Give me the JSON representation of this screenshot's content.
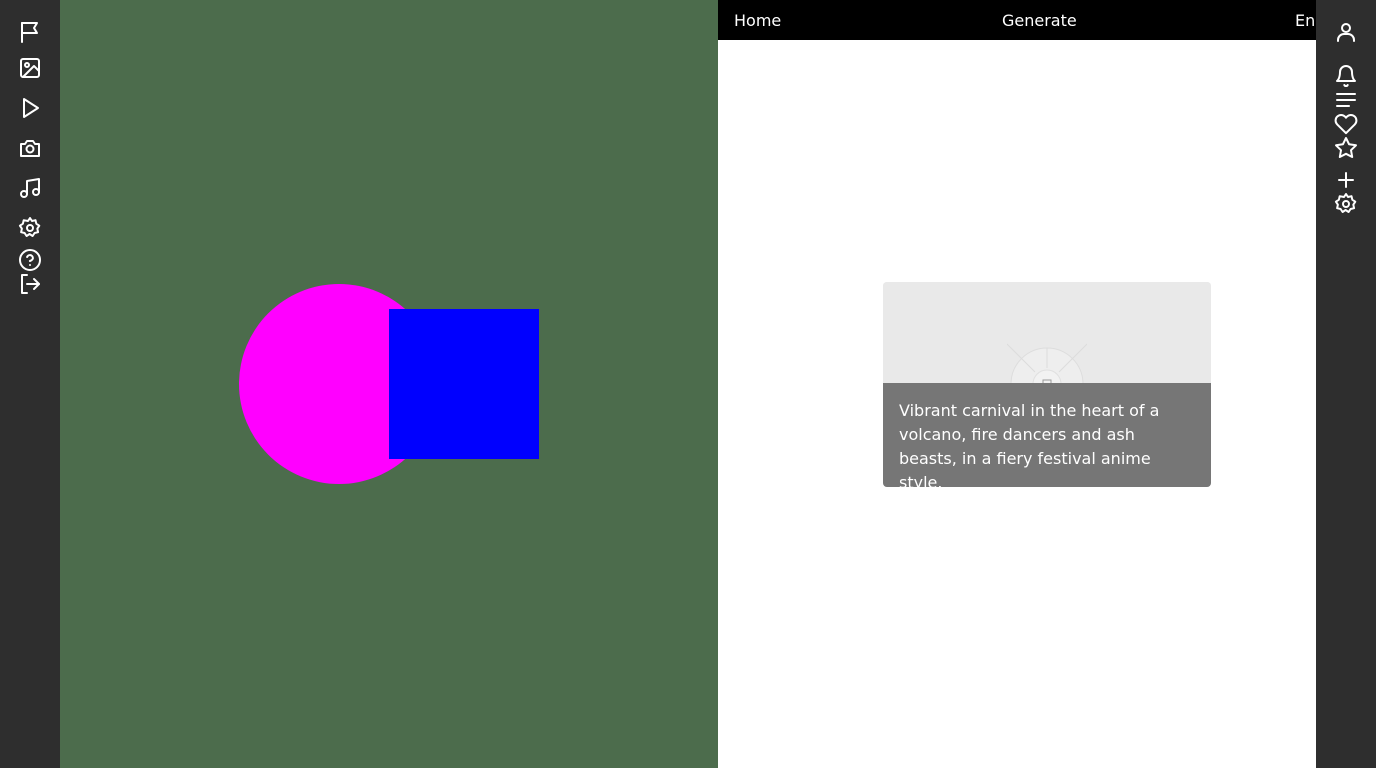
{
  "nav": {
    "home": "Home",
    "generate": "Generate",
    "third": "Enh"
  },
  "card": {
    "caption": "Vibrant carnival in the heart of a volcano, fire dancers and ash beasts, in a fiery festival anime style."
  },
  "canvas": {
    "background": "#4c6c4c",
    "circle_color": "#ff00ff",
    "square_color": "#0000ff"
  },
  "left_rail_icons": [
    "flag-icon",
    "image-icon",
    "play-icon",
    "camera-icon",
    "music-icon",
    "settings-icon",
    "help-icon",
    "logout-icon"
  ],
  "right_rail_icons": [
    "user-icon",
    "bell-icon",
    "menu-icon",
    "heart-icon",
    "star-icon",
    "plus-icon",
    "settings-icon"
  ]
}
